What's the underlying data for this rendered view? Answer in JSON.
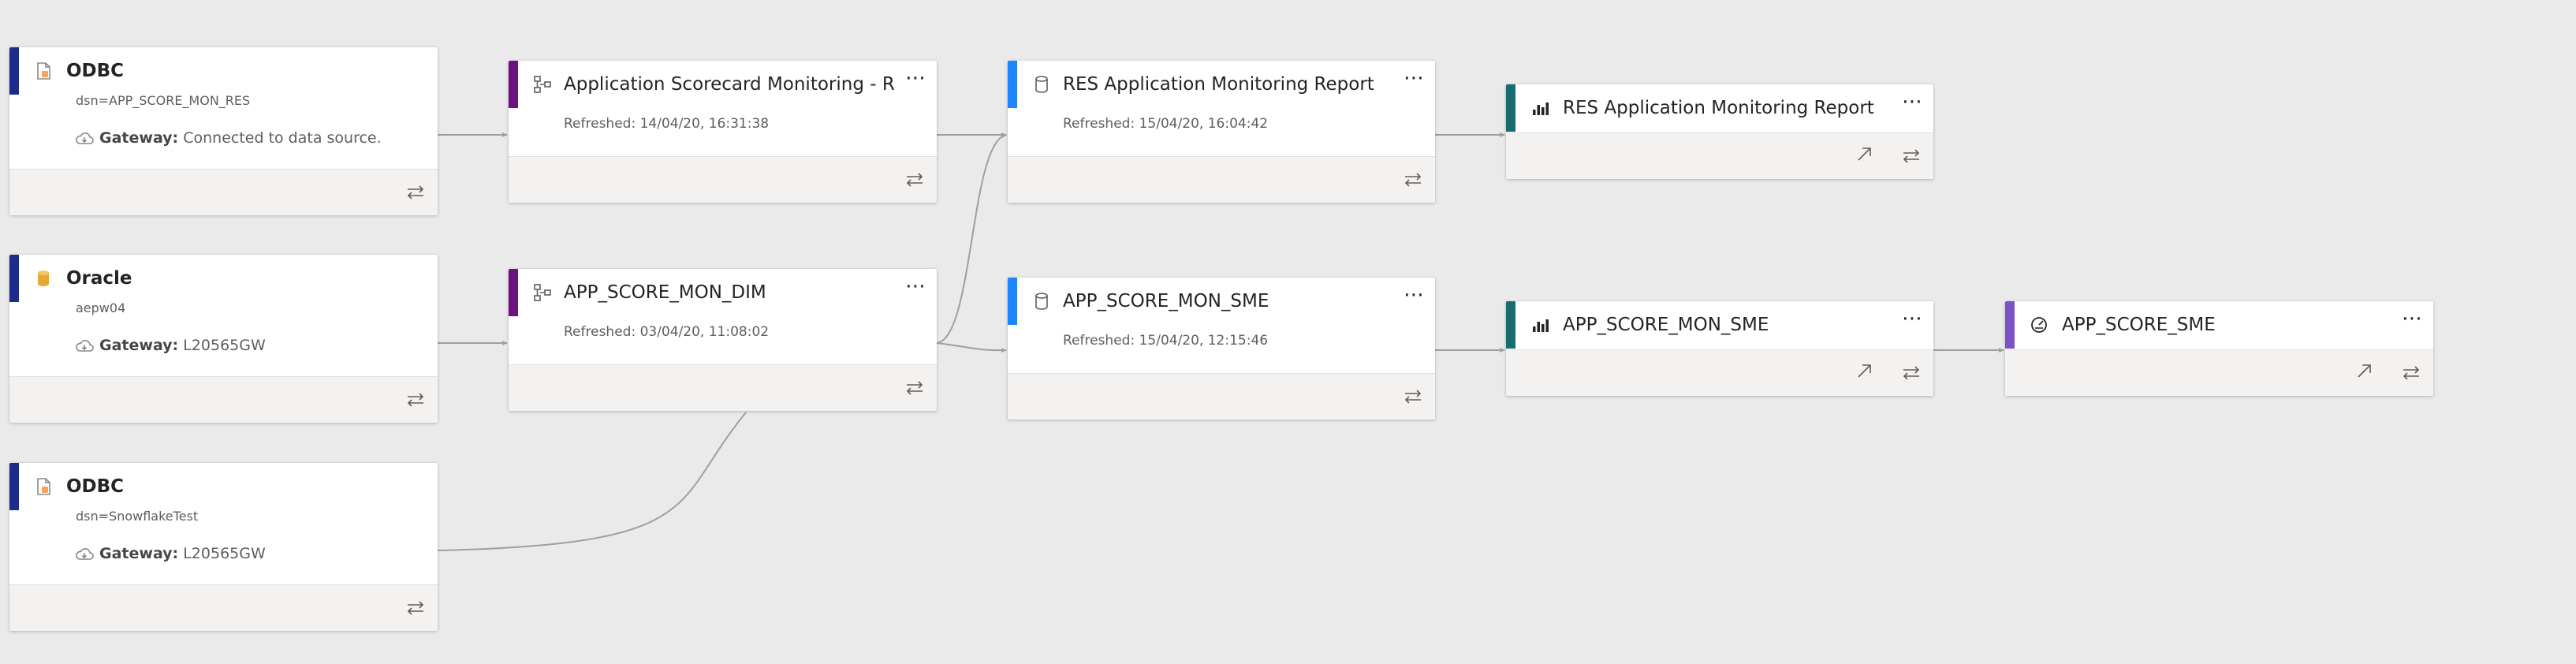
{
  "colors": {
    "datasource": "#1c2b8c",
    "dataflow": "#6e1180",
    "dataset": "#1f85ff",
    "report": "#176c70",
    "dashboard": "#7a52c7",
    "background": "#eaeaea",
    "connector": "#a19f9d"
  },
  "sources": [
    {
      "type_icon": "odbc-file-icon",
      "title": "ODBC",
      "subtitle": "dsn=APP_SCORE_MON_RES",
      "gateway_label": "Gateway:",
      "gateway_value": "Connected to data source."
    },
    {
      "type_icon": "oracle-database-icon",
      "title": "Oracle",
      "subtitle": "aepw04",
      "gateway_label": "Gateway:",
      "gateway_value": "L20565GW"
    },
    {
      "type_icon": "odbc-file-icon",
      "title": "ODBC",
      "subtitle": "dsn=SnowflakeTest",
      "gateway_label": "Gateway:",
      "gateway_value": "L20565GW"
    }
  ],
  "dataflows": [
    {
      "type_icon": "dataflow-icon",
      "title": "Application Scorecard Monitoring - Resid...",
      "refreshed": "Refreshed: 14/04/20, 16:31:38"
    },
    {
      "type_icon": "dataflow-icon",
      "title": "APP_SCORE_MON_DIM",
      "refreshed": "Refreshed: 03/04/20, 11:08:02"
    }
  ],
  "datasets": [
    {
      "type_icon": "dataset-icon",
      "title": "RES Application Monitoring Report",
      "refreshed": "Refreshed: 15/04/20, 16:04:42"
    },
    {
      "type_icon": "dataset-icon",
      "title": "APP_SCORE_MON_SME",
      "refreshed": "Refreshed: 15/04/20, 12:15:46"
    }
  ],
  "reports": [
    {
      "type_icon": "report-chart-icon",
      "title": "RES Application Monitoring Report"
    },
    {
      "type_icon": "report-chart-icon",
      "title": "APP_SCORE_MON_SME"
    }
  ],
  "dashboards": [
    {
      "type_icon": "dashboard-gauge-icon",
      "title": "APP_SCORE_SME"
    }
  ],
  "actions": {
    "more": "⋯",
    "lineage_icon": "lineage-arrows-icon",
    "open_icon": "open-arrow-icon"
  }
}
